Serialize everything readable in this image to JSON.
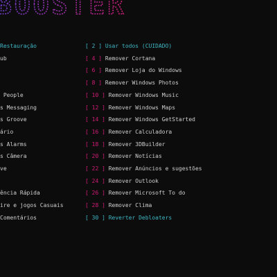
{
  "colors": {
    "background": "#0c0c0c",
    "accent_pink": "#d31c78",
    "accent_cyan": "#3fb8c6",
    "text": "#cfcfcf"
  },
  "banner": {
    "title": "BOOSTER"
  },
  "left_menu": [
    {
      "label": "Restauração",
      "highlight": true
    },
    {
      "label": "ub",
      "highlight": false
    },
    {
      "label": "",
      "highlight": false
    },
    {
      "label": "",
      "highlight": false
    },
    {
      "label": " People",
      "highlight": false
    },
    {
      "label": "s Messaging",
      "highlight": false
    },
    {
      "label": "s Groove",
      "highlight": false
    },
    {
      "label": "ário",
      "highlight": false
    },
    {
      "label": "s Alarms",
      "highlight": false
    },
    {
      "label": "s Câmera",
      "highlight": false
    },
    {
      "label": "ve",
      "highlight": false
    },
    {
      "label": "",
      "highlight": false
    },
    {
      "label": "ência Rápida",
      "highlight": false
    },
    {
      "label": "ire e jogos Casuais",
      "highlight": false
    },
    {
      "label": "Comentários",
      "highlight": false
    }
  ],
  "right_menu": [
    {
      "num": "[ 2 ]",
      "label": "Usar todos (CUIDADO)",
      "highlight": true
    },
    {
      "num": "[ 4 ]",
      "label": "Remover Cortana",
      "highlight": false
    },
    {
      "num": "[ 6 ]",
      "label": "Remover Loja do Windows",
      "highlight": false
    },
    {
      "num": "[ 8 ]",
      "label": "Remover Windows Photos",
      "highlight": false
    },
    {
      "num": "[ 10 ]",
      "label": "Remover Windows Music",
      "highlight": false
    },
    {
      "num": "[ 12 ]",
      "label": "Remover Windows Maps",
      "highlight": false
    },
    {
      "num": "[ 14 ]",
      "label": "Remover Windows GetStarted",
      "highlight": false
    },
    {
      "num": "[ 16 ]",
      "label": "Remover Calculadora",
      "highlight": false
    },
    {
      "num": "[ 18 ]",
      "label": "Remover 3DBuilder",
      "highlight": false
    },
    {
      "num": "[ 20 ]",
      "label": "Remover Notícias",
      "highlight": false
    },
    {
      "num": "[ 22 ]",
      "label": "Remover Anúncios e sugestões",
      "highlight": false
    },
    {
      "num": "[ 24 ]",
      "label": "Remover Outlook",
      "highlight": false
    },
    {
      "num": "[ 26 ]",
      "label": "Remover Microsoft To do",
      "highlight": false
    },
    {
      "num": "[ 28 ]",
      "label": "Remover Clima",
      "highlight": false
    },
    {
      "num": "[ 30 ]",
      "label": "Reverter Debloaters",
      "highlight": true
    }
  ]
}
